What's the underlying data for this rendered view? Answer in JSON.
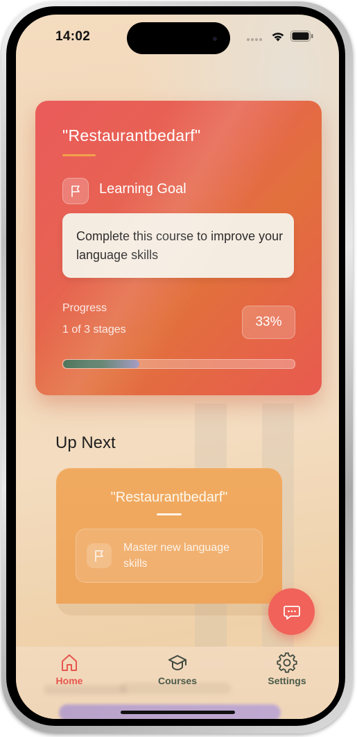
{
  "status_bar": {
    "time": "14:02"
  },
  "current_course": {
    "title": "\"Restaurantbedarf\"",
    "goal_label": "Learning Goal",
    "goal_text": "Complete this course to improve your language skills",
    "progress_label": "Progress",
    "stages_text": "1 of 3 stages",
    "percent_text": "33%",
    "progress_fraction": 0.33
  },
  "up_next": {
    "heading": "Up Next",
    "title": "\"Restaurantbedarf\"",
    "goal_text": "Master new language skills"
  },
  "tabs": [
    {
      "label": "Home",
      "icon": "home-icon",
      "active": true
    },
    {
      "label": "Courses",
      "icon": "graduation-cap-icon",
      "active": false
    },
    {
      "label": "Settings",
      "icon": "gear-icon",
      "active": false
    }
  ],
  "colors": {
    "accent": "#e5564e",
    "card_gradient_start": "#ea5b5b",
    "card_gradient_end": "#e2703c",
    "next_card": "#f0aa60",
    "fab": "#f0625a",
    "inactive_tab": "#4a5a4a"
  }
}
